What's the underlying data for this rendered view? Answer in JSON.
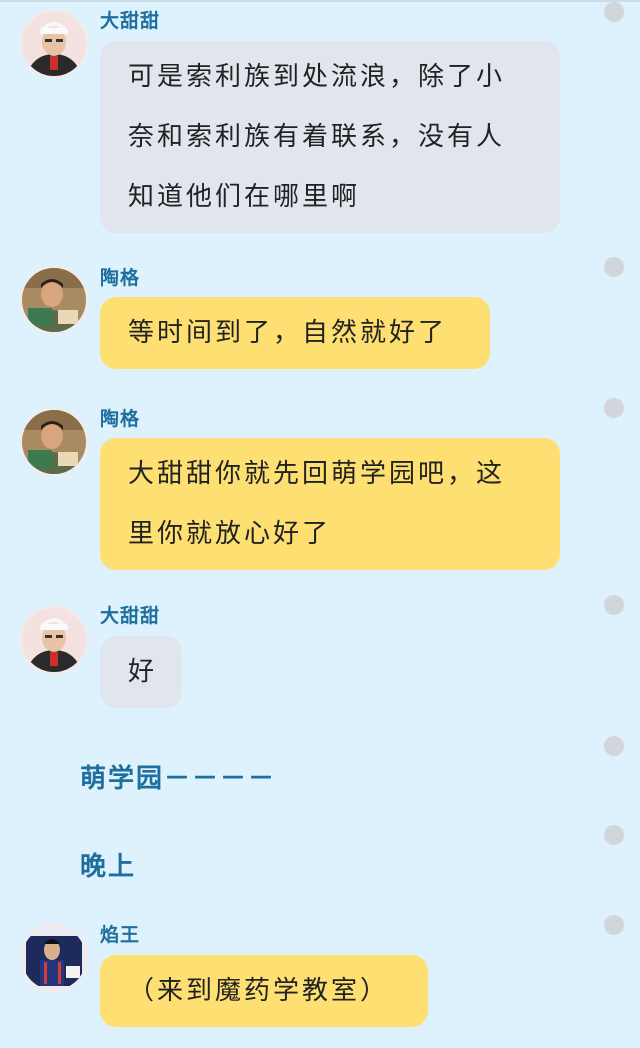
{
  "messages": [
    {
      "speaker": "大甜甜",
      "text": "可是索利族到处流浪，除了小奈和索利族有着联系，没有人知道他们在哪里啊",
      "style": "gray"
    },
    {
      "speaker": "陶格",
      "text": "等时间到了，自然就好了",
      "style": "yellow"
    },
    {
      "speaker": "陶格",
      "text": "大甜甜你就先回萌学园吧，这里你就放心好了",
      "style": "yellow"
    },
    {
      "speaker": "大甜甜",
      "text": "好",
      "style": "gray"
    },
    {
      "narration": "萌学园－－－－"
    },
    {
      "narration": "晚上"
    },
    {
      "speaker": "焰王",
      "text": "（来到魔药学教室）",
      "style": "yellow"
    }
  ],
  "colors": {
    "background": "#ddf2fc",
    "name": "#1f6f9e",
    "bubble_gray": "#e1e6ee",
    "bubble_yellow": "#fde071",
    "dot": "#d2d5d9"
  }
}
